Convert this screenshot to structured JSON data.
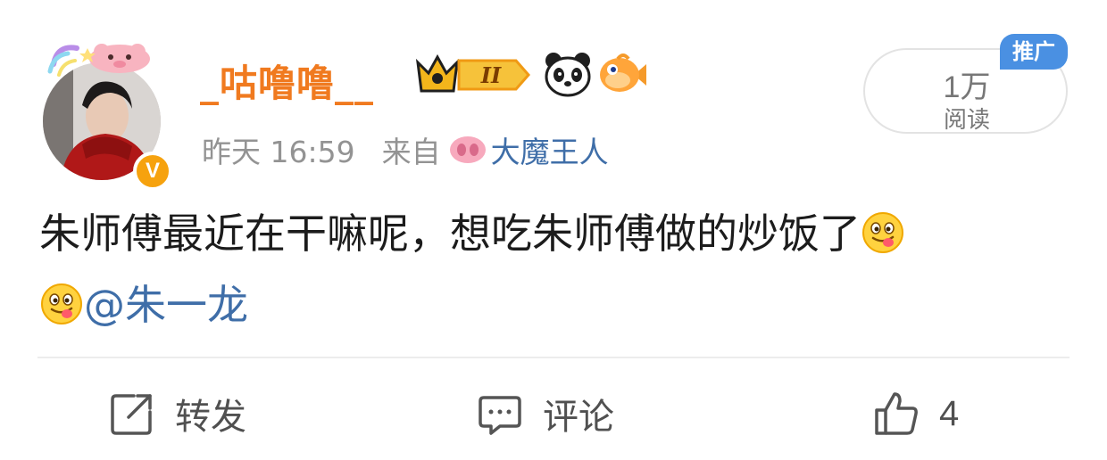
{
  "post": {
    "author": {
      "username": "_咕噜噜__",
      "verified_symbol": "V",
      "badges": [
        "crown-level-badge",
        "panda-icon",
        "fish-icon"
      ],
      "level_badge_text": "II"
    },
    "meta": {
      "time": "昨天 16:59",
      "from_label": "来自",
      "source": "大魔王人"
    },
    "views": {
      "count": "1万",
      "label": "阅读"
    },
    "promo_tag": "推广",
    "content": {
      "text": "朱师傅最近在干嘛呢，想吃朱师傅做的炒饭了",
      "mention": "@朱一龙",
      "emoji": "tongue-out-emoji"
    },
    "actions": {
      "repost_label": "转发",
      "comment_label": "评论",
      "like_count": "4"
    }
  },
  "colors": {
    "username": "#f07a1f",
    "link": "#3f6ea8",
    "meta": "#939393",
    "promo": "#4a90e2",
    "verified": "#f6a20e"
  }
}
